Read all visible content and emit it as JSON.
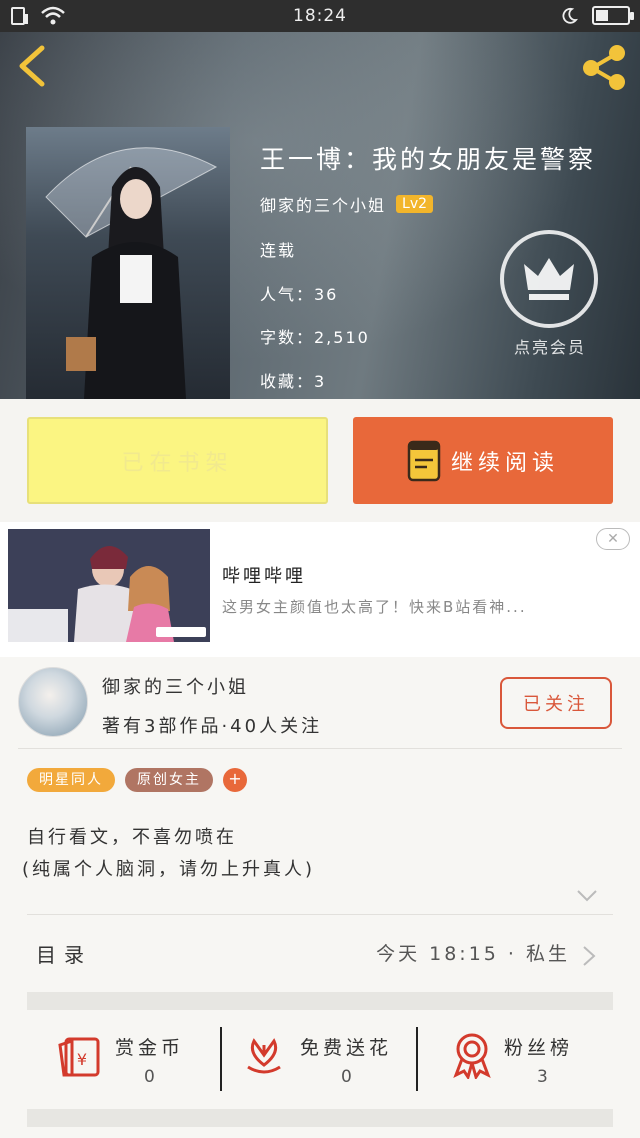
{
  "status_bar": {
    "time": "18:24"
  },
  "book": {
    "title": "王一博：我的女朋友是警察",
    "author": "御家的三个小姐",
    "level": "Lv2",
    "status": "连载",
    "popularity": "人气：36",
    "word_count": "字数：2,510",
    "favorites": "收藏：3"
  },
  "vip": {
    "label": "点亮会员"
  },
  "actions": {
    "shelf_label": "已在书架",
    "read_label": "继续阅读"
  },
  "ad": {
    "title": "哔哩哔哩",
    "description": "这男女主颜值也太高了！快来B站看神..."
  },
  "author_card": {
    "name": "御家的三个小姐",
    "stats": "著有3部作品·40人关注",
    "follow_label": "已关注"
  },
  "tags": [
    {
      "label": "明星同人",
      "color": "#f2a93b"
    },
    {
      "label": "原创女主",
      "color": "#b07563"
    }
  ],
  "description": [
    "自行看文，不喜勿喷在",
    "(纯属个人脑洞，请勿上升真人)"
  ],
  "toc": {
    "label": "目录",
    "latest": "今天 18:15 · 私生"
  },
  "stats": [
    {
      "label": "赏金币",
      "value": "0",
      "icon": "red-envelope-icon"
    },
    {
      "label": "免费送花",
      "value": "0",
      "icon": "flower-icon"
    },
    {
      "label": "粉丝榜",
      "value": "3",
      "icon": "award-ribbon-icon"
    }
  ],
  "colors": {
    "accent": "#e8683a",
    "shelf_yellow": "#fbf582",
    "level_badge": "#f2b52b",
    "icon_red": "#d33a2c"
  }
}
